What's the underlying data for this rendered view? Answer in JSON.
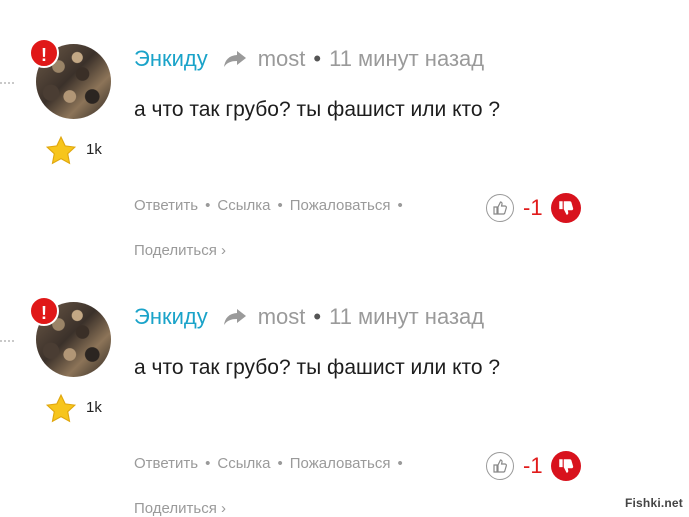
{
  "comments": [
    {
      "username": "Энкиду",
      "reply_to": "most",
      "separator": "•",
      "time": "11 минут назад",
      "badge": "!",
      "rating": "1k",
      "text": "а что так грубо? ты фашист или кто ?",
      "actions": {
        "reply": "Ответить",
        "link": "Ссылка",
        "report": "Пожаловаться",
        "sep": "•",
        "share": "Поделиться ›"
      },
      "score": "-1"
    },
    {
      "username": "Энкиду",
      "reply_to": "most",
      "separator": "•",
      "time": "11 минут назад",
      "badge": "!",
      "rating": "1k",
      "text": "а что так грубо? ты фашист или кто ?",
      "actions": {
        "reply": "Ответить",
        "link": "Ссылка",
        "report": "Пожаловаться",
        "sep": "•",
        "share": "Поделиться ›"
      },
      "score": "-1"
    }
  ],
  "watermark": "Fishki.net",
  "colors": {
    "username": "#1aa3c9",
    "negative": "#e11b1b",
    "muted": "#9a9a9a",
    "badge": "#e01818"
  }
}
